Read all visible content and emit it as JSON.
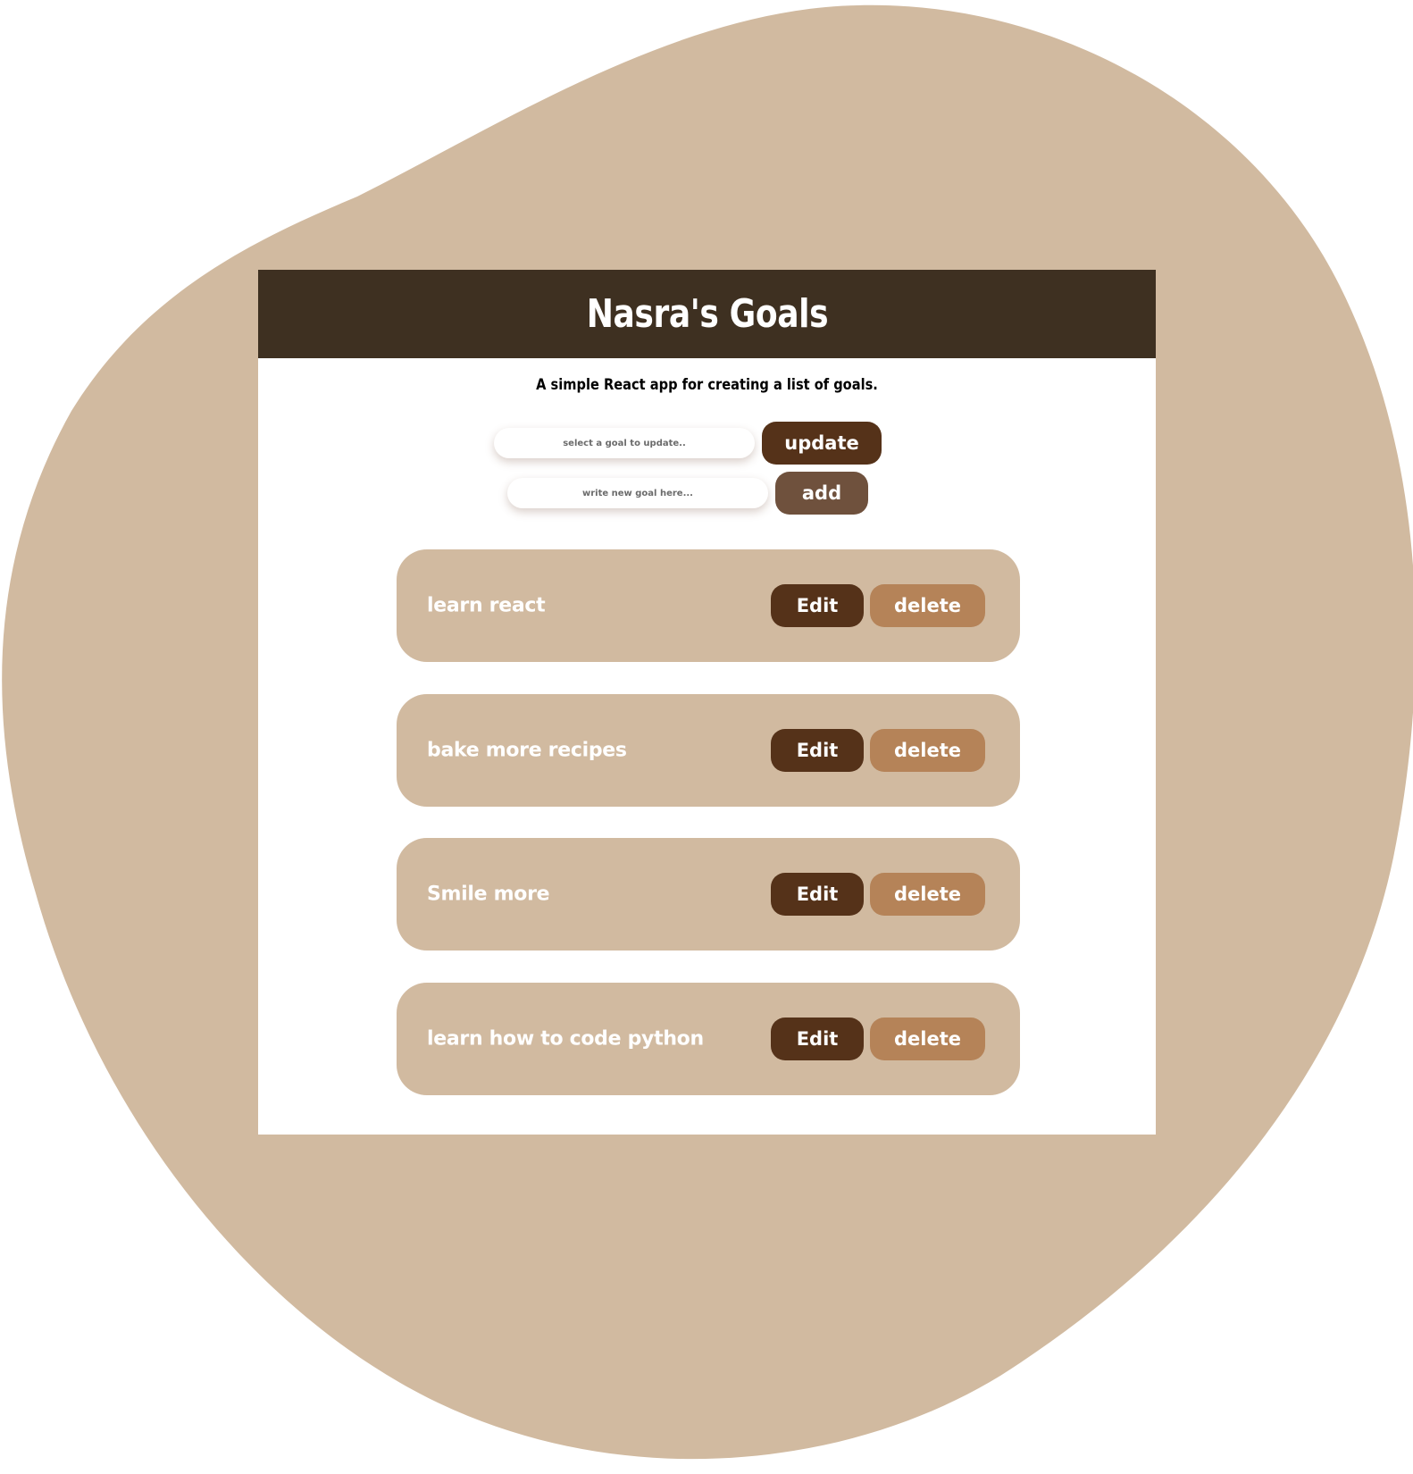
{
  "colors": {
    "blob": "#d1baa0",
    "header": "#3e3021",
    "update_button": "#553219",
    "add_button": "#6f513d",
    "goal_card": "#d1baa0",
    "edit_button": "#553219",
    "delete_button": "#b58358"
  },
  "header": {
    "title": "Nasra's Goals"
  },
  "subtitle": "A simple React app for creating a list of goals.",
  "form": {
    "update_placeholder": "select a goal to update..",
    "update_label": "update",
    "add_placeholder": "write new goal here...",
    "add_label": "add"
  },
  "goals": [
    {
      "text": "learn react",
      "edit_label": "Edit",
      "delete_label": "delete"
    },
    {
      "text": "bake more recipes",
      "edit_label": "Edit",
      "delete_label": "delete"
    },
    {
      "text": "Smile more",
      "edit_label": "Edit",
      "delete_label": "delete"
    },
    {
      "text": "learn how to code python",
      "edit_label": "Edit",
      "delete_label": "delete"
    }
  ]
}
